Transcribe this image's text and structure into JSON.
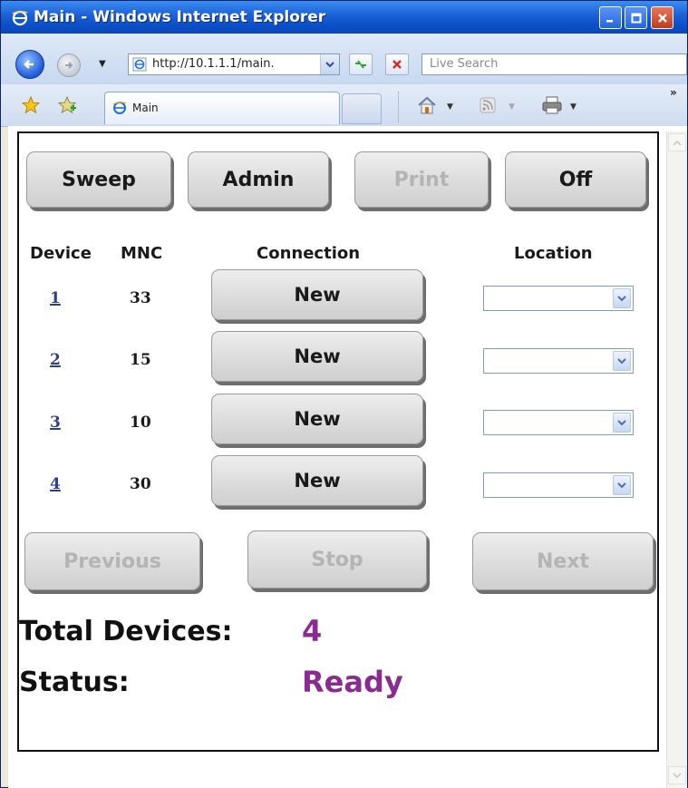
{
  "window": {
    "title": "Main - Windows Internet Explorer"
  },
  "browser": {
    "url": "http://10.1.1.1/main.",
    "search_placeholder": "Live Search",
    "tab_label": "Main",
    "chevron": "»"
  },
  "toolbar": {
    "sweep_label": "Sweep",
    "admin_label": "Admin",
    "print_label": "Print",
    "off_label": "Off"
  },
  "table": {
    "headers": {
      "device": "Device",
      "mnc": "MNC",
      "connection": "Connection",
      "location": "Location"
    },
    "rows": [
      {
        "device": "1",
        "mnc": "33",
        "connection": "New",
        "location": ""
      },
      {
        "device": "2",
        "mnc": "15",
        "connection": "New",
        "location": ""
      },
      {
        "device": "3",
        "mnc": "10",
        "connection": "New",
        "location": ""
      },
      {
        "device": "4",
        "mnc": "30",
        "connection": "New",
        "location": ""
      }
    ]
  },
  "pager": {
    "previous_label": "Previous",
    "stop_label": "Stop",
    "next_label": "Next"
  },
  "summary": {
    "total_label": "Total Devices:",
    "total_value": "4",
    "status_label": "Status:",
    "status_value": "Ready"
  },
  "colors": {
    "accent_value": "#8a2b8f",
    "link": "#2d3f8f",
    "disabled_text": "#b4b4b4"
  }
}
